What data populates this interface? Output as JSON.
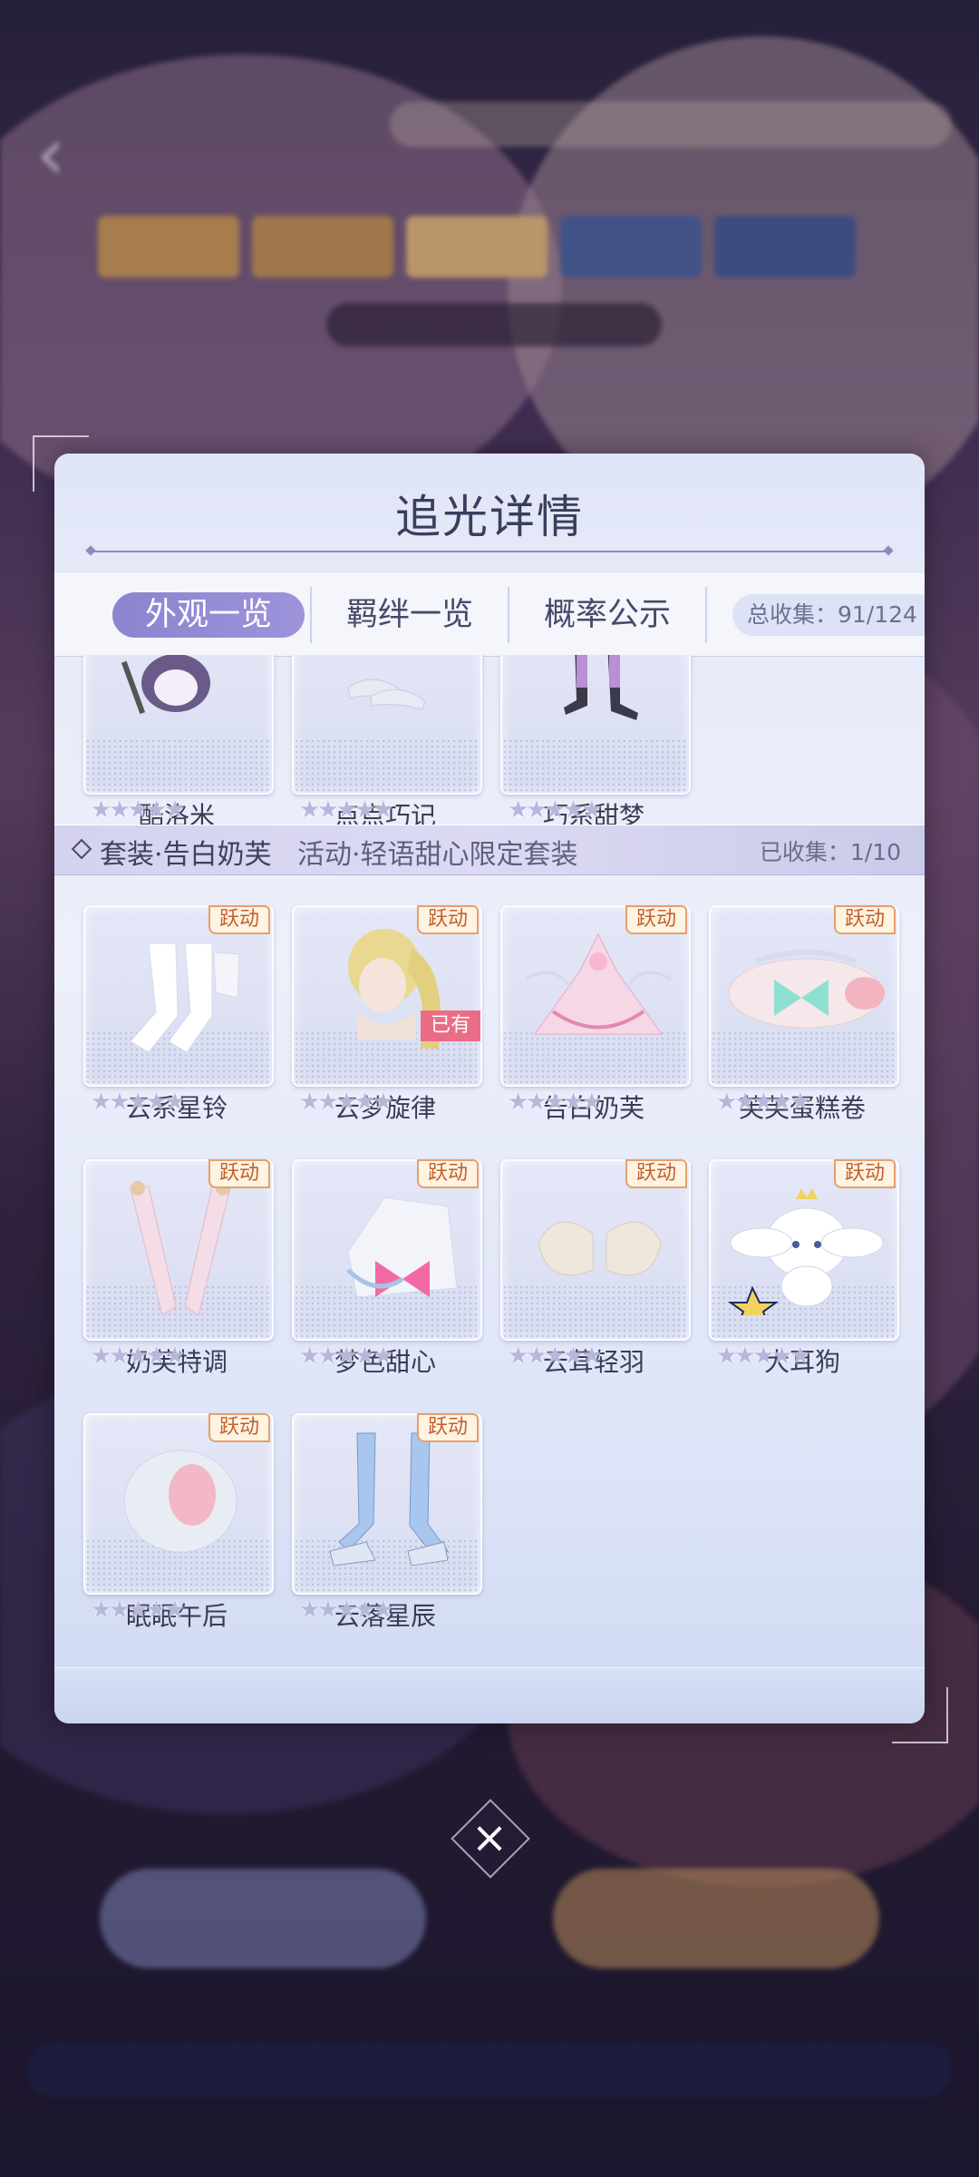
{
  "modal": {
    "title": "追光详情",
    "tabs": [
      {
        "label": "外观一览",
        "active": true
      },
      {
        "label": "羁绊一览",
        "active": false
      },
      {
        "label": "概率公示",
        "active": false
      }
    ],
    "total_collected": "总收集：91/124"
  },
  "top_row": [
    {
      "name": "酷洛米"
    },
    {
      "name": "点点巧记"
    },
    {
      "name": "巧系甜梦"
    }
  ],
  "set": {
    "name": "套装·告白奶芙",
    "event": "活动·轻语甜心限定套装",
    "collected": "已收集：1/10",
    "items": [
      {
        "name": "云系星铃",
        "badge": "跃动",
        "owned": ""
      },
      {
        "name": "云梦旋律",
        "badge": "跃动",
        "owned": "已有"
      },
      {
        "name": "告白奶芙",
        "badge": "跃动",
        "owned": ""
      },
      {
        "name": "芙芙蛋糕卷",
        "badge": "跃动",
        "owned": ""
      },
      {
        "name": "奶芙特调",
        "badge": "跃动",
        "owned": ""
      },
      {
        "name": "梦色甜心",
        "badge": "跃动",
        "owned": ""
      },
      {
        "name": "云茸轻羽",
        "badge": "跃动",
        "owned": ""
      },
      {
        "name": "大耳狗",
        "badge": "跃动",
        "owned": ""
      },
      {
        "name": "眠眠午后",
        "badge": "跃动",
        "owned": ""
      },
      {
        "name": "云落星辰",
        "badge": "跃动",
        "owned": ""
      }
    ]
  },
  "stars": "★★★★★",
  "close_icon": "×",
  "back_icon": "‹",
  "colors": {
    "tab_active": "#8c84cf",
    "badge_border": "#e5a06c",
    "owned_bg": "#ea6d86"
  }
}
